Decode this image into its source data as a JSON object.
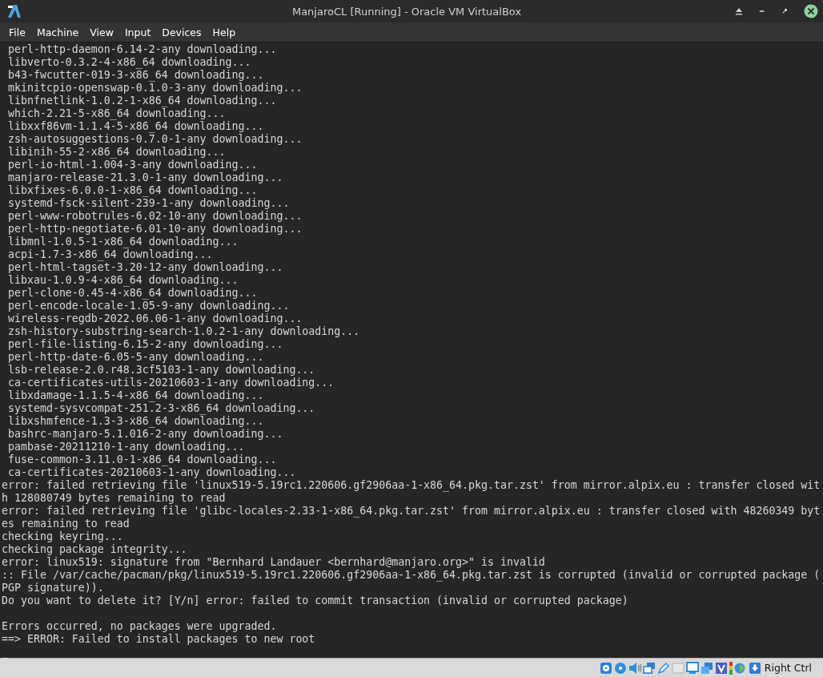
{
  "window": {
    "title": "ManjaroCL [Running] - Oracle VM VirtualBox"
  },
  "menu": [
    "File",
    "Machine",
    "View",
    "Input",
    "Devices",
    "Help"
  ],
  "console_blocks": [
    {
      "lines": [
        " perl-http-daemon-6.14-2-any downloading...",
        " libverto-0.3.2-4-x86_64 downloading...",
        " b43-fwcutter-019-3-x86_64 downloading...",
        " mkinitcpio-openswap-0.1.0-3-any downloading...",
        " libnfnetlink-1.0.2-1-x86_64 downloading...",
        " which-2.21-5-x86_64 downloading...",
        " libxxf86vm-1.1.4-5-x86_64 downloading...",
        " zsh-autosuggestions-0.7.0-1-any downloading...",
        " libinih-55-2-x86_64 downloading...",
        " perl-io-html-1.004-3-any downloading...",
        " manjaro-release-21.3.0-1-any downloading...",
        " libxfixes-6.0.0-1-x86_64 downloading...",
        " systemd-fsck-silent-239-1-any downloading...",
        " perl-www-robotrules-6.02-10-any downloading...",
        " perl-http-negotiate-6.01-10-any downloading...",
        " libmnl-1.0.5-1-x86_64 downloading...",
        " acpi-1.7-3-x86_64 downloading...",
        " perl-html-tagset-3.20-12-any downloading...",
        " libxau-1.0.9-4-x86_64 downloading...",
        " perl-clone-0.45-4-x86_64 downloading...",
        " perl-encode-locale-1.05-9-any downloading...",
        " wireless-regdb-2022.06.06-1-any downloading...",
        " zsh-history-substring-search-1.0.2-1-any downloading...",
        " perl-file-listing-6.15-2-any downloading...",
        " perl-http-date-6.05-5-any downloading...",
        " lsb-release-2.0.r48.3cf5103-1-any downloading...",
        " ca-certificates-utils-20210603-1-any downloading...",
        " libxdamage-1.1.5-4-x86_64 downloading...",
        " systemd-sysvcompat-251.2-3-x86_64 downloading...",
        " libxshmfence-1.3-3-x86_64 downloading...",
        " bashrc-manjaro-5.1.016-2-any downloading...",
        " pambase-20211210-1-any downloading...",
        " fuse-common-3.11.0-1-x86_64 downloading...",
        " ca-certificates-20210603-1-any downloading...",
        "error: failed retrieving file 'linux519-5.19rc1.220606.gf2906aa-1-x86_64.pkg.tar.zst' from mirror.alpix.eu : transfer closed wit",
        "h 128080749 bytes remaining to read",
        "error: failed retrieving file 'glibc-locales-2.33-1-x86_64.pkg.tar.zst' from mirror.alpix.eu : transfer closed with 48260349 byt",
        "es remaining to read",
        "checking keyring...",
        "checking package integrity...",
        "error: linux519: signature from \"Bernhard Landauer <bernhard@manjaro.org>\" is invalid",
        ":: File /var/cache/pacman/pkg/linux519-5.19rc1.220606.gf2906aa-1-x86_64.pkg.tar.zst is corrupted (invalid or corrupted package (",
        "PGP signature)).",
        "Do you want to delete it? [Y/n] error: failed to commit transaction (invalid or corrupted package)"
      ]
    },
    {
      "lines": [
        "Errors occurred, no packages were upgraded.",
        "==> ERROR: Failed to install packages to new root"
      ]
    }
  ],
  "status_bar": {
    "host_key": "Right Ctrl"
  }
}
